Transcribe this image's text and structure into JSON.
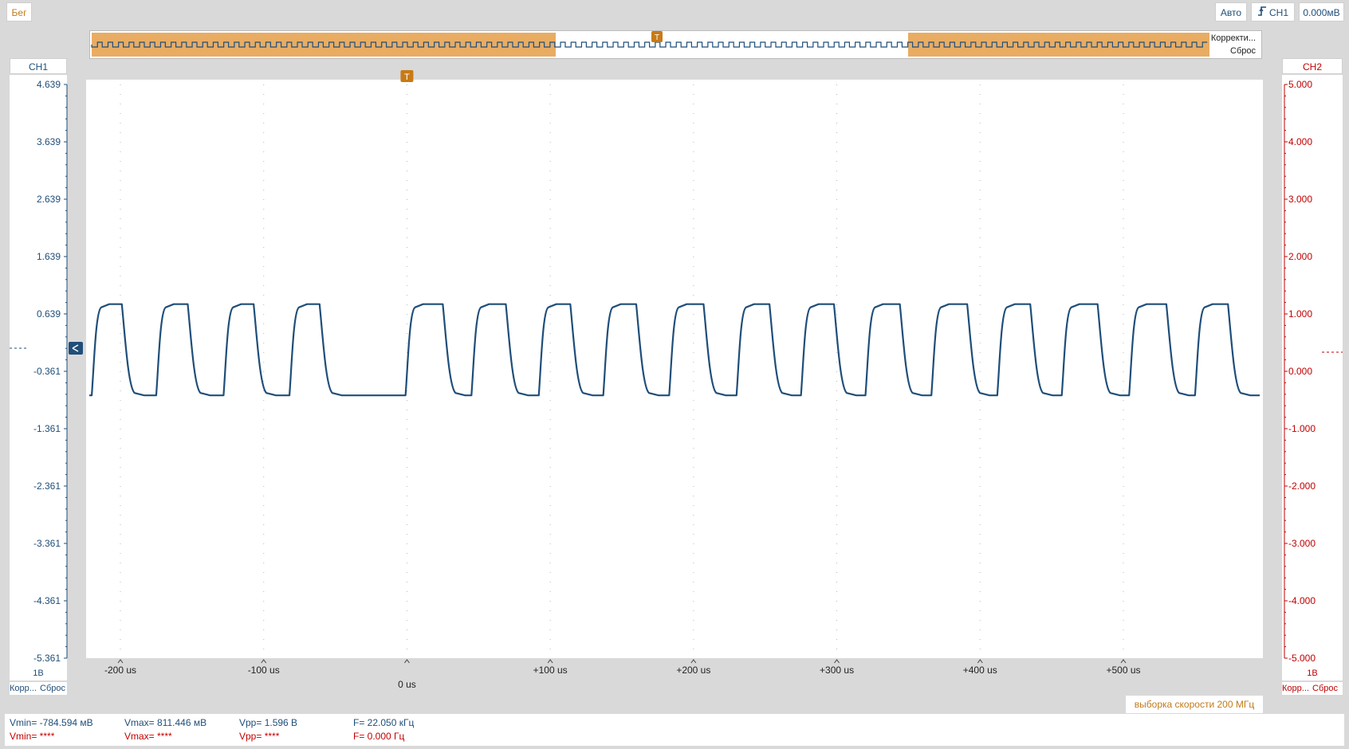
{
  "toolbar": {
    "run_state": "Бег",
    "trigger_mode": "Авто",
    "trigger_source": "CH1",
    "trigger_level": "0.000мВ"
  },
  "overview": {
    "correct_label": "Корректи...",
    "reset_label": "Сброс",
    "trigger_marker": "T"
  },
  "ch1": {
    "label": "CH1",
    "scale": "1В",
    "corr_label": "Корр...",
    "reset_label": "Сброс",
    "ticks": [
      "4.639",
      "3.639",
      "2.639",
      "1.639",
      "0.639",
      "-0.361",
      "-1.361",
      "-2.361",
      "-3.361",
      "-4.361",
      "-5.361"
    ],
    "color": "#1f4e79"
  },
  "ch2": {
    "label": "CH2",
    "scale": "1В",
    "corr_label": "Корр...",
    "reset_label": "Сброс",
    "ticks": [
      "5.000",
      "4.000",
      "3.000",
      "2.000",
      "1.000",
      "0.000",
      "-1.000",
      "-2.000",
      "-3.000",
      "-4.000",
      "-5.000"
    ],
    "color": "#c00000"
  },
  "plot": {
    "trigger_marker": "T",
    "x_ticks": [
      "-200 us",
      "-100 us",
      "0 us",
      "+100 us",
      "+200 us",
      "+300 us",
      "+400 us",
      "+500 us"
    ]
  },
  "chart_data": {
    "type": "line",
    "title": "",
    "xlabel": "",
    "ylabel": "",
    "x_unit": "us",
    "xlim": [
      -220,
      600
    ],
    "ylim_ch1": [
      -5.361,
      4.639
    ],
    "series": [
      {
        "name": "CH1",
        "waveform": "square",
        "low_v": -0.78,
        "high_v": 0.81,
        "rising_edges_us": [
          -220,
          -175,
          -128,
          -82,
          -1,
          45,
          92,
          137,
          183,
          230,
          275,
          320,
          366,
          412,
          457,
          504,
          550
        ],
        "falling_edges_us": [
          -199,
          -153,
          -107,
          -61,
          25,
          69,
          114,
          160,
          207,
          253,
          298,
          344,
          391,
          435,
          482,
          530,
          573
        ]
      }
    ]
  },
  "footer": {
    "sample_rate": "выборка скорости 200 МГц"
  },
  "measurements": {
    "ch1": {
      "vmin": "Vmin= -784.594 мВ",
      "vmax": "Vmax= 811.446 мВ",
      "vpp": "Vpp= 1.596 В",
      "freq": "F= 22.050 кГц"
    },
    "ch2": {
      "vmin": "Vmin= ****",
      "vmax": "Vmax= ****",
      "vpp": "Vpp= ****",
      "freq": "F= 0.000 Гц"
    }
  }
}
